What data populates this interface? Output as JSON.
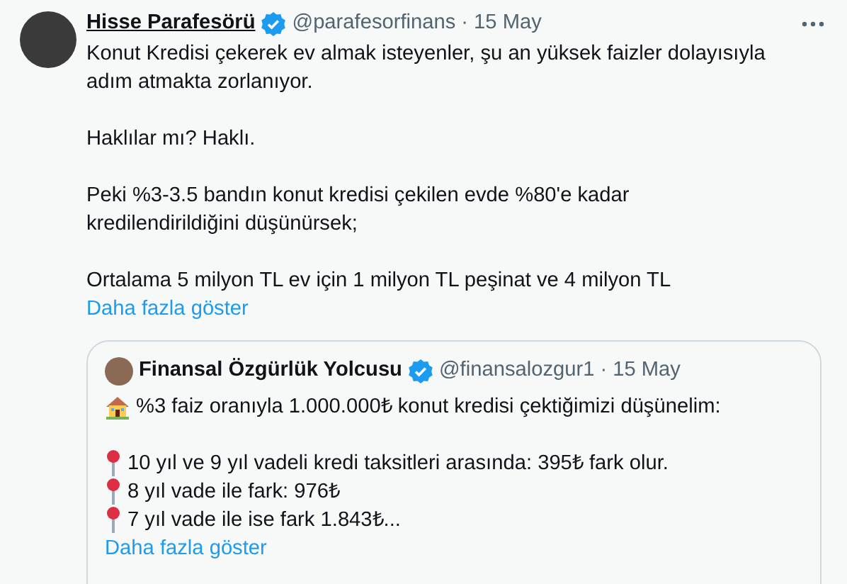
{
  "tweet": {
    "author": "Hisse Parafesörü",
    "verified": true,
    "handle": "@parafesorfinans",
    "separator": "·",
    "date": "15 May",
    "paragraphs": [
      [
        "Konut Kredisi çekerek ev almak isteyenler, şu an yüksek faizler dolayısıyla",
        "adım atmakta zorlanıyor."
      ],
      [
        "Haklılar mı? Haklı."
      ],
      [
        "Peki %3-3.5 bandın konut kredisi çekilen evde %80'e kadar",
        "kredilendirildiğini düşünürsek;"
      ],
      [
        "Ortalama 5 milyon TL ev için 1 milyon TL peşinat ve 4 milyon TL"
      ]
    ],
    "show_more": "Daha fazla göster",
    "quote": {
      "author": "Finansal Özgürlük Yolcusu",
      "verified": true,
      "handle": "@finansalozgur1",
      "separator": "·",
      "date": "15 May",
      "lines": [
        {
          "kind": "house",
          "text": "%3 faiz oranıyla 1.000.000₺ konut kredisi çektiğimizi düşünelim:"
        },
        {
          "kind": "blank"
        },
        {
          "kind": "pin",
          "text": "10 yıl ve 9 yıl vadeli kredi taksitleri arasında: 395₺ fark olur."
        },
        {
          "kind": "pin",
          "text": "8 yıl vade ile fark: 976₺"
        },
        {
          "kind": "pin",
          "text": "7 yıl vade ile ise fark 1.843₺..."
        }
      ],
      "show_more": "Daha fazla göster"
    }
  }
}
